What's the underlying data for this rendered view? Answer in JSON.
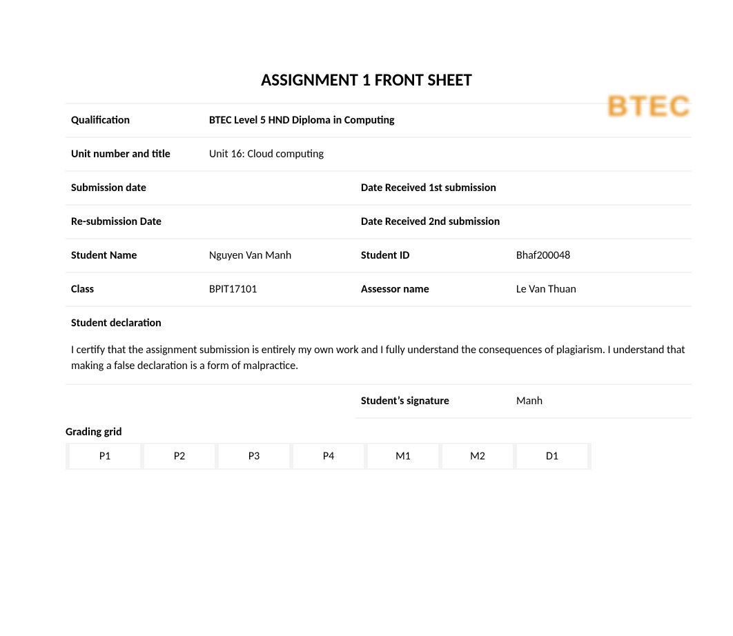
{
  "logo": "BTEC",
  "title": "ASSIGNMENT 1 FRONT SHEET",
  "fields": {
    "qualification_label": "Qualification",
    "qualification_value": "BTEC Level 5 HND Diploma in Computing",
    "unit_label": "Unit number and title",
    "unit_value": "Unit 16: Cloud computing",
    "submission_date_label": "Submission date",
    "submission_date_value": "",
    "date_received_1_label": "Date Received 1st submission",
    "date_received_1_value": "",
    "resubmission_date_label": "Re-submission Date",
    "resubmission_date_value": "",
    "date_received_2_label": "Date Received 2nd submission",
    "date_received_2_value": "",
    "student_name_label": "Student Name",
    "student_name_value": "Nguyen Van Manh",
    "student_id_label": "Student ID",
    "student_id_value": "Bhaf200048",
    "class_label": "Class",
    "class_value": "BPIT17101",
    "assessor_label": "Assessor name",
    "assessor_value": "Le Van Thuan",
    "declaration_label": "Student declaration",
    "declaration_text": "I certify that the assignment submission is entirely my own work and I fully understand the consequences of plagiarism. I understand that making a false declaration is a form of malpractice.",
    "signature_label": "Student’s signature",
    "signature_value": "Manh"
  },
  "grading": {
    "title": "Grading grid",
    "columns": [
      "P1",
      "P2",
      "P3",
      "P4",
      "M1",
      "M2",
      "D1"
    ]
  }
}
